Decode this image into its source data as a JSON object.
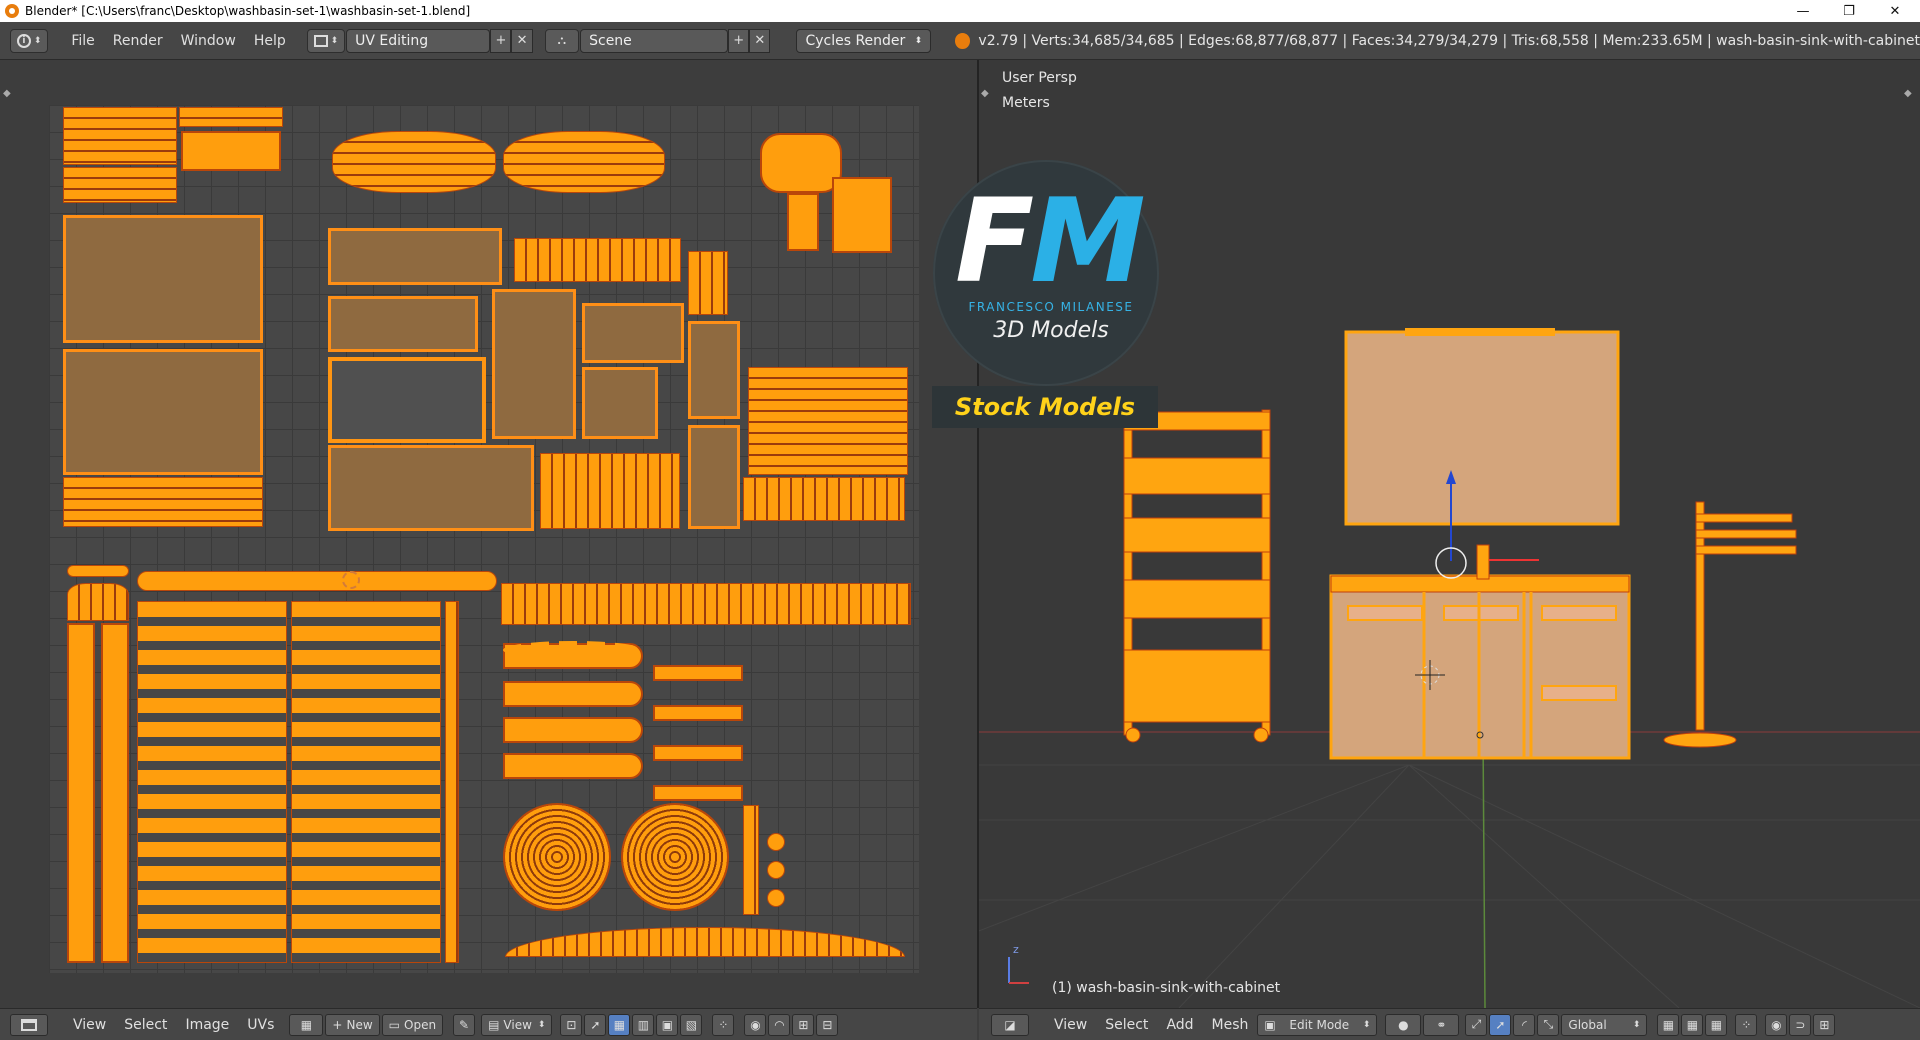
{
  "window": {
    "title": "Blender* [C:\\Users\\franc\\Desktop\\washbasin-set-1\\washbasin-set-1.blend]",
    "minimize_glyph": "—",
    "restore_glyph": "❐",
    "close_glyph": "✕"
  },
  "info_header": {
    "editor_icon": "info-icon",
    "menus": [
      "File",
      "Render",
      "Window",
      "Help"
    ],
    "screen_layout": "UV Editing",
    "scene": "Scene",
    "render_engine": "Cycles Render",
    "stats": "v2.79 | Verts:34,685/34,685 | Edges:68,877/68,877 | Faces:34,279/34,279 | Tris:68,558 | Mem:233.65M | wash-basin-sink-with-cabinet",
    "add_glyph": "+",
    "remove_glyph": "✕"
  },
  "viewport": {
    "view_name": "User Persp",
    "units": "Meters",
    "object_label": "(1) wash-basin-sink-with-cabinet",
    "axis_z": "z"
  },
  "watermark": {
    "letter_f": "F",
    "letter_m": "M",
    "author": "FRANCESCO MILANESE",
    "tagline": "3D Models",
    "banner": "Stock Models"
  },
  "uv_footer": {
    "menus": [
      "View",
      "Select",
      "Image",
      "UVs"
    ],
    "new_label": "New",
    "open_label": "Open",
    "view_label": "View"
  },
  "viewport_footer": {
    "menus": [
      "View",
      "Select",
      "Add",
      "Mesh"
    ],
    "mode": "Edit Mode",
    "orientation": "Global"
  },
  "colors": {
    "selected_mesh": "#ff9e0d",
    "uv_edge": "#b9460a",
    "header_bg": "#464646",
    "accent_blue": "#2bb0e6",
    "banner_yellow": "#ffd21a"
  }
}
